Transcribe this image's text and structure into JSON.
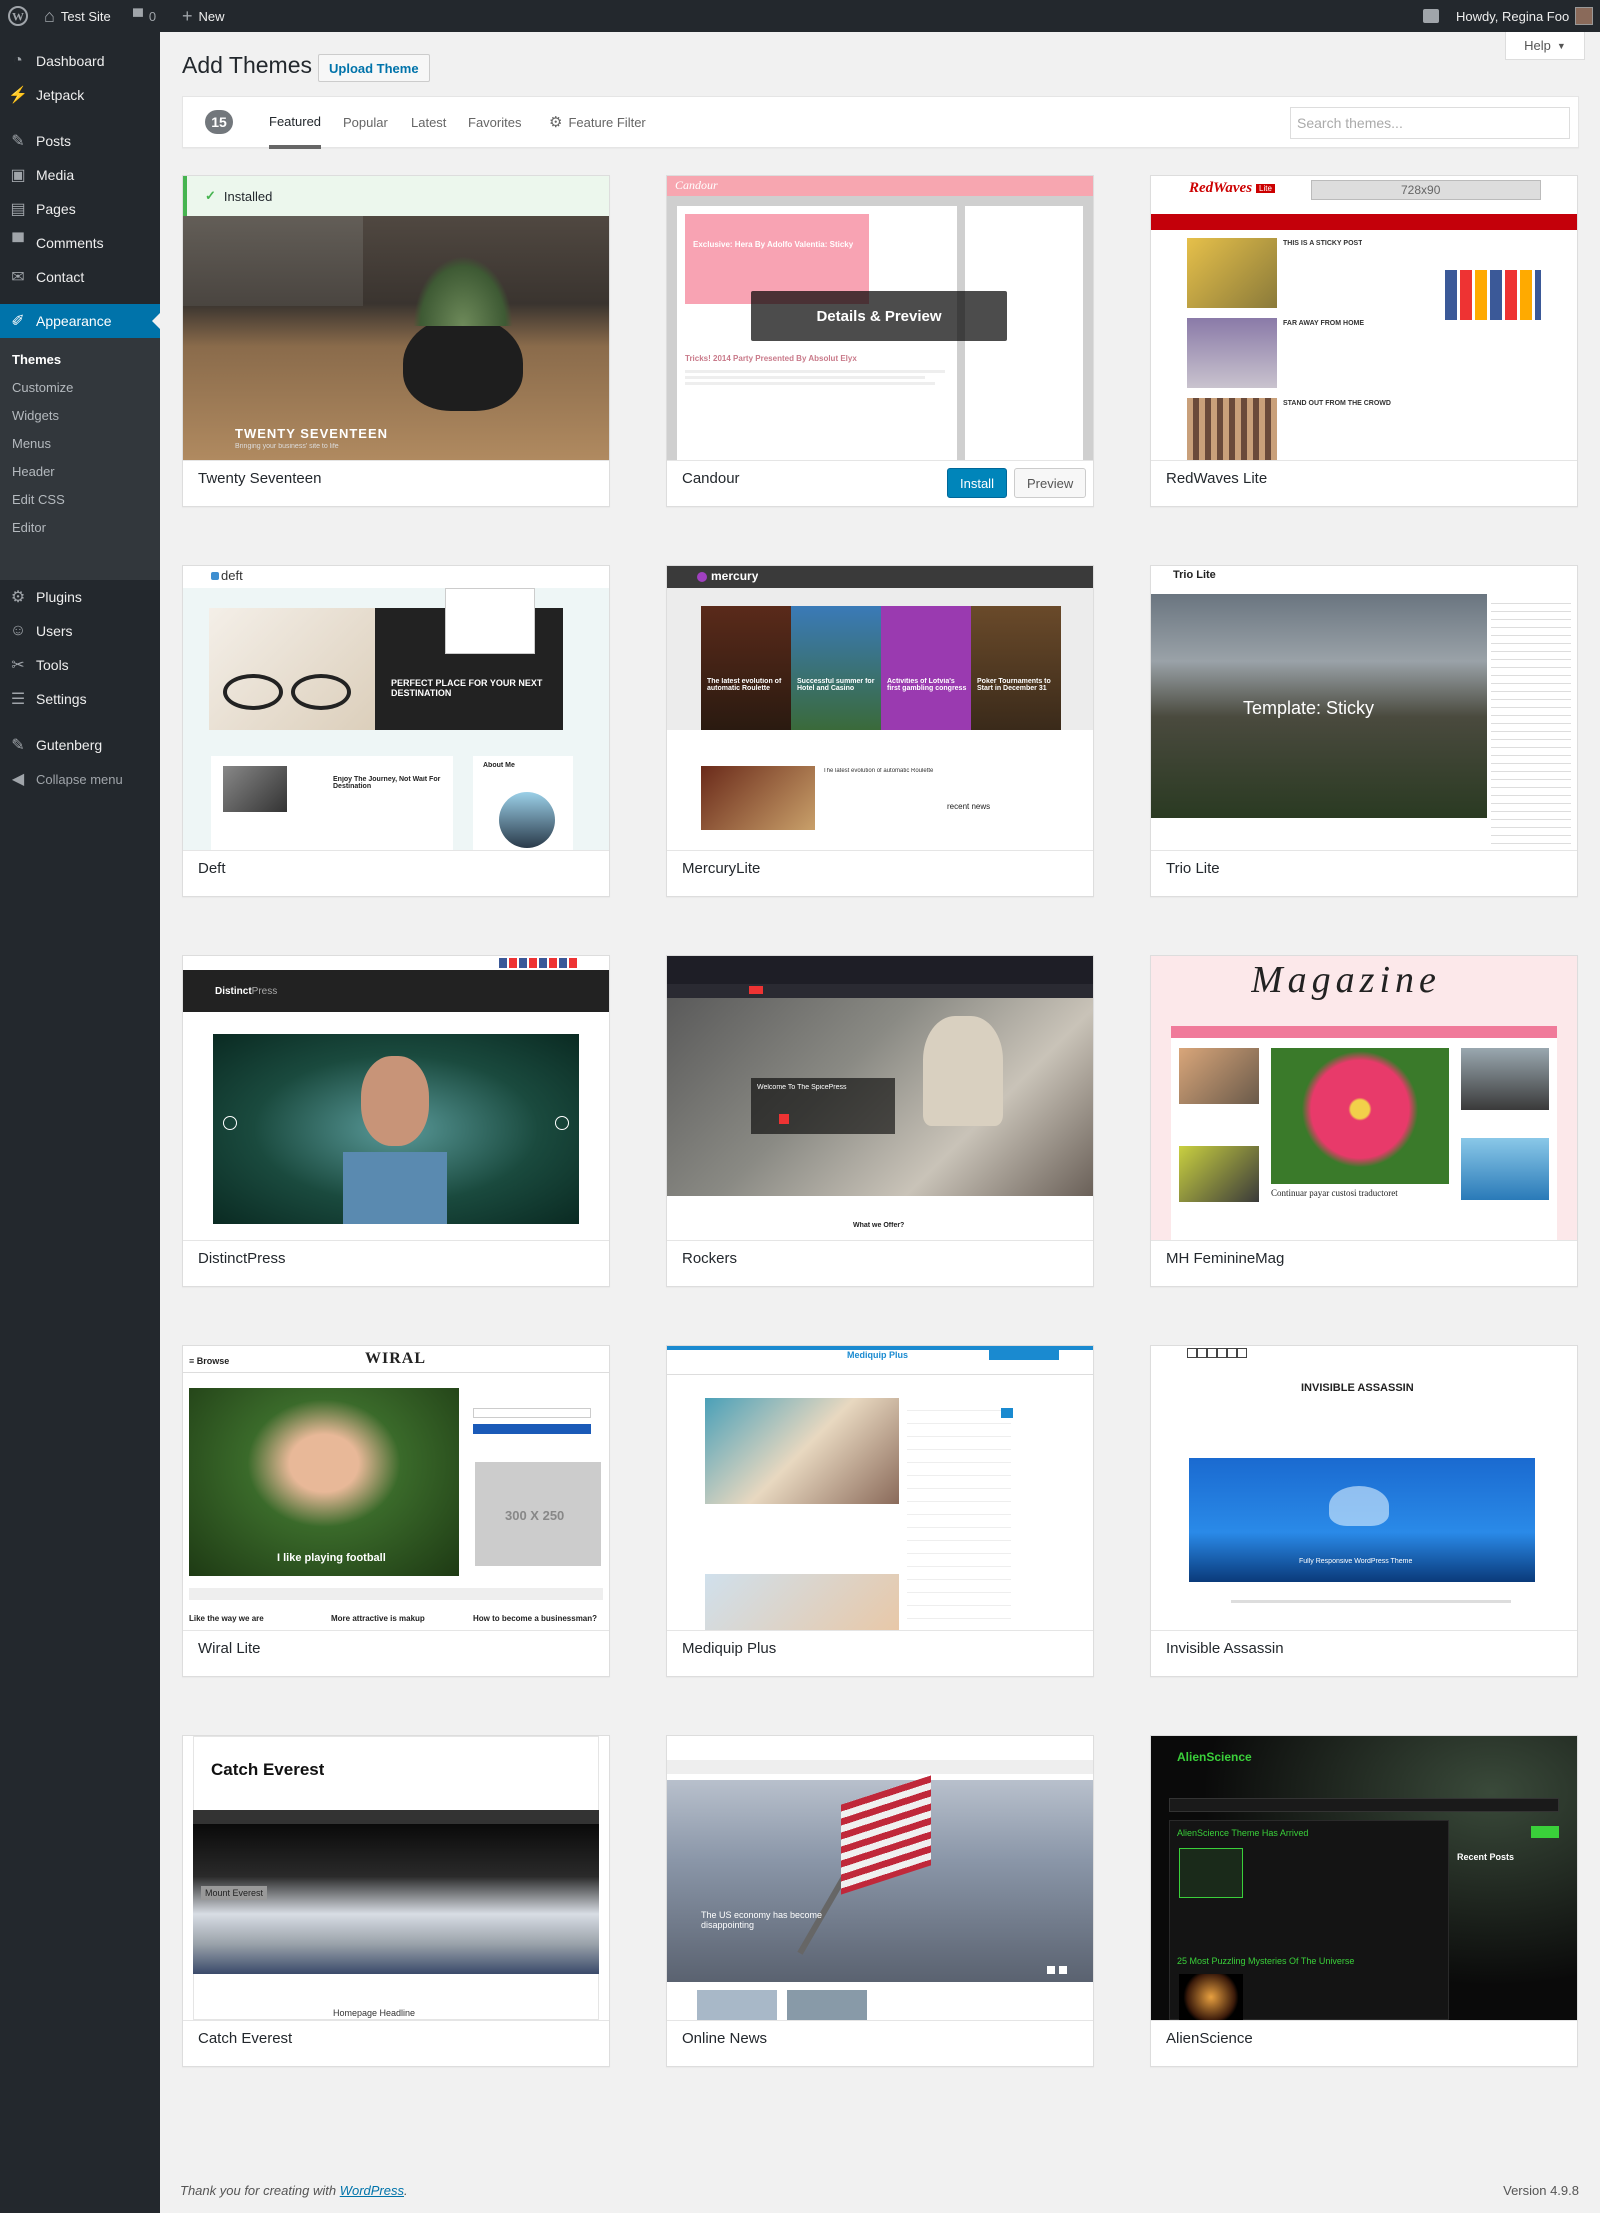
{
  "admin_bar": {
    "site_name": "Test Site",
    "comments_count": "0",
    "new_label": "New",
    "howdy": "Howdy, Regina Foo"
  },
  "menu": {
    "items": [
      {
        "label": "Dashboard",
        "icon": "dashboard-icon"
      },
      {
        "label": "Jetpack",
        "icon": "jetpack-icon"
      },
      {
        "label": "Posts",
        "icon": "pin-icon"
      },
      {
        "label": "Media",
        "icon": "media-icon"
      },
      {
        "label": "Pages",
        "icon": "pages-icon"
      },
      {
        "label": "Comments",
        "icon": "comments-icon"
      },
      {
        "label": "Contact",
        "icon": "contact-icon"
      },
      {
        "label": "Appearance",
        "icon": "brush-icon"
      },
      {
        "label": "Plugins",
        "icon": "plug-icon"
      },
      {
        "label": "Users",
        "icon": "users-icon"
      },
      {
        "label": "Tools",
        "icon": "wrench-icon"
      },
      {
        "label": "Settings",
        "icon": "settings-icon"
      },
      {
        "label": "Gutenberg",
        "icon": "gutenberg-icon"
      },
      {
        "label": "Collapse menu",
        "icon": "collapse-icon"
      }
    ],
    "appearance_sub": [
      "Themes",
      "Customize",
      "Widgets",
      "Menus",
      "Header",
      "Edit CSS",
      "Editor"
    ]
  },
  "help_label": "Help",
  "page_title": "Add Themes",
  "upload_label": "Upload Theme",
  "filter": {
    "count": "15",
    "tabs": [
      "Featured",
      "Popular",
      "Latest",
      "Favorites"
    ],
    "feature_filter": "Feature Filter",
    "search_placeholder": "Search themes..."
  },
  "themes": [
    {
      "name": "Twenty Seventeen",
      "installed_label": "Installed",
      "shot_title": "TWENTY SEVENTEEN",
      "shot_sub": "Bringing your business' site to life"
    },
    {
      "name": "Candour",
      "overlay": "Details & Preview",
      "install": "Install",
      "preview": "Preview",
      "post1": "Exclusive: Hera By Adolfo Valentia: Sticky",
      "post2": "Tricks! 2014 Party Presented By Absolut Elyx"
    },
    {
      "name": "RedWaves Lite",
      "ad": "728x90",
      "logo": "RedWaves",
      "logo_tag": "Lite",
      "p1": "THIS IS A STICKY POST",
      "p2": "FAR AWAY FROM HOME",
      "p3": "STAND OUT FROM THE CROWD"
    },
    {
      "name": "Deft",
      "logo": "deft",
      "slider": "PERFECT PLACE FOR YOUR NEXT DESTINATION",
      "post": "Enjoy The Journey, Not Wait For Destination",
      "about": "About Me"
    },
    {
      "name": "MercuryLite",
      "logo": "mercury",
      "t1": "The latest evolution of automatic Roulette",
      "t2": "Successful summer for Hotel and Casino",
      "t3": "Activities of Lotvia's first gambling congress",
      "t4": "Poker Tournaments to Start in December 31",
      "recent": "recent news"
    },
    {
      "name": "Trio Lite",
      "logo": "Trio Lite",
      "hero": "Template: Sticky"
    },
    {
      "name": "DistinctPress",
      "logo": "Distinct",
      "logo2": "Press"
    },
    {
      "name": "Rockers",
      "welcome": "Welcome To The SpicePress",
      "offer": "What we Offer?"
    },
    {
      "name": "MH FeminineMag",
      "logo": "Magazine",
      "caption": "Continuar payar custosi traductoret"
    },
    {
      "name": "Wiral Lite",
      "logo": "WIRAL",
      "browse": "Browse",
      "photo_caption": "I like playing football",
      "ad": "300 X 250",
      "h1": "Like the way we are",
      "h2": "More attractive is makup",
      "h3": "How to become a businessman?"
    },
    {
      "name": "Mediquip Plus",
      "logo": "Mediquip Plus"
    },
    {
      "name": "Invisible Assassin",
      "logo": "INVISIBLE ASSASSIN",
      "hero": "Fully Responsive WordPress Theme"
    },
    {
      "name": "Catch Everest",
      "logo": "Catch Everest",
      "tag": "Mount Everest",
      "headline": "Homepage Headline"
    },
    {
      "name": "Online News",
      "caption": "The US economy has become disappointing"
    },
    {
      "name": "AlienScience",
      "logo": "AlienScience",
      "h1": "AlienScience Theme Has Arrived",
      "h2": "25 Most Puzzling Mysteries Of The Universe",
      "recent": "Recent Posts"
    }
  ],
  "footer": {
    "thanks_prefix": "Thank you for creating with ",
    "thanks_link": "WordPress",
    "version": "Version 4.9.8"
  },
  "colors": {
    "accent": "#0073aa",
    "installed": "#46b450",
    "adminbar": "#23282d"
  }
}
